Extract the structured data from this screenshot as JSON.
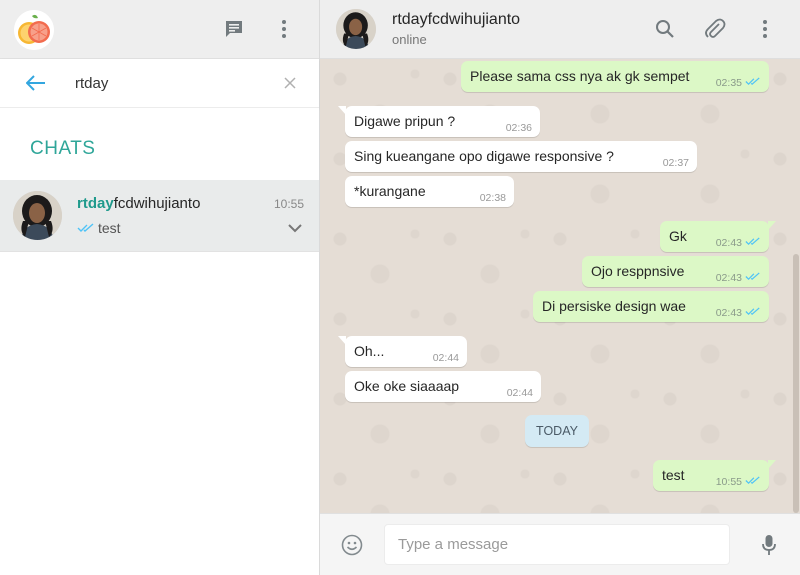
{
  "colors": {
    "accent": "#2fa699",
    "outgoing_bubble": "#dcf8c6",
    "incoming_bubble": "#ffffff",
    "chat_bg": "#e5ddd5",
    "tick_read": "#4fc3f7"
  },
  "sidebar": {
    "header": {
      "avatar_icon": "grapefruit-avatar",
      "new_chat_icon": "message-icon",
      "menu_icon": "more-vertical-icon"
    },
    "search": {
      "value": "rtday",
      "back_icon": "arrow-left-icon",
      "clear_icon": "close-icon"
    },
    "section_title": "CHATS",
    "chats": [
      {
        "name_highlight": "rtday",
        "name_rest": "fcdwihujianto",
        "time": "10:55",
        "preview": "test",
        "status_icon": "double-check-icon"
      }
    ]
  },
  "conversation": {
    "contact_name": "rtdayfcdwihujianto",
    "status": "online",
    "icons": [
      "search-icon",
      "attach-icon",
      "more-vertical-icon"
    ],
    "messages": [
      {
        "dir": "out",
        "text": "Please sama css nya ak gk sempet",
        "time": "02:35"
      },
      {
        "dir": "in",
        "text": "Digawe pripun ?",
        "time": "02:36"
      },
      {
        "dir": "in",
        "text": "Sing kueangane opo digawe responsive ?",
        "time": "02:37"
      },
      {
        "dir": "in",
        "text": "*kurangane",
        "time": "02:38"
      },
      {
        "dir": "out",
        "text": "Gk",
        "time": "02:43"
      },
      {
        "dir": "out",
        "text": "Ojo resppnsive",
        "time": "02:43"
      },
      {
        "dir": "out",
        "text": "Di persiske design wae",
        "time": "02:43"
      },
      {
        "dir": "in",
        "text": "Oh...",
        "time": "02:44"
      },
      {
        "dir": "in",
        "text": "Oke oke siaaaap",
        "time": "02:44"
      },
      {
        "dir": "out",
        "text": "test",
        "time": "10:55"
      }
    ],
    "date_divider": "TODAY"
  },
  "compose": {
    "placeholder": "Type a message",
    "emoji_icon": "smiley-icon",
    "mic_icon": "microphone-icon"
  }
}
